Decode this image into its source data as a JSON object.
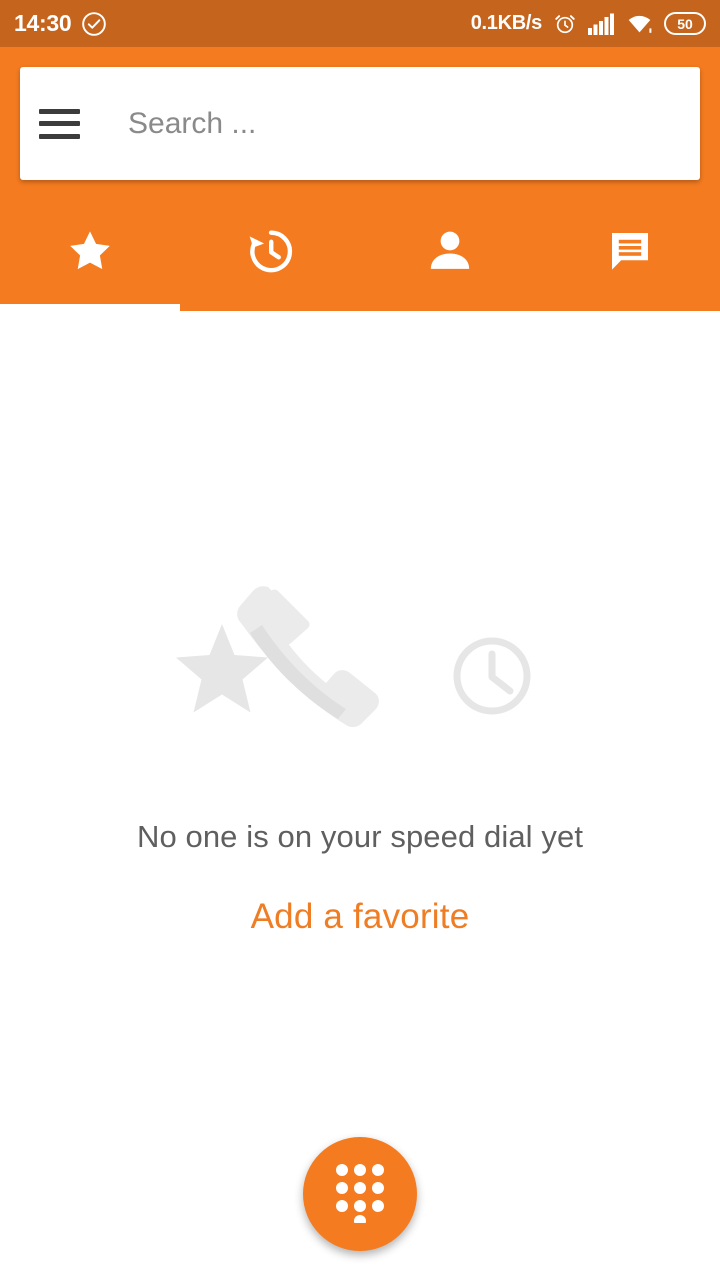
{
  "status_bar": {
    "time": "14:30",
    "check_icon": "check-circle-icon",
    "network_speed": "0.1KB/s",
    "alarm_icon": "alarm-clock-icon",
    "signal_icon": "cellular-signal-icon",
    "wifi_icon": "wifi-icon",
    "battery_level": "50",
    "background_color": "#c5651d"
  },
  "app_bar": {
    "background_color": "#f47b20",
    "menu_icon": "hamburger-menu-icon",
    "search": {
      "value": "",
      "placeholder": "Search ..."
    },
    "tabs": [
      {
        "id": "favorites",
        "icon": "star-icon",
        "active": true
      },
      {
        "id": "recents",
        "icon": "history-clock-icon",
        "active": false
      },
      {
        "id": "contacts",
        "icon": "person-icon",
        "active": false
      },
      {
        "id": "messages",
        "icon": "message-bubble-icon",
        "active": false
      }
    ]
  },
  "content": {
    "empty_state": {
      "illustration": "star-phone-clock-illustration",
      "title": "No one is on your speed dial yet",
      "action_label": "Add a favorite",
      "title_color": "#5f5f5f",
      "action_color": "#ef7d24"
    }
  },
  "fab": {
    "icon": "dialpad-icon",
    "background_color": "#f47b20"
  }
}
